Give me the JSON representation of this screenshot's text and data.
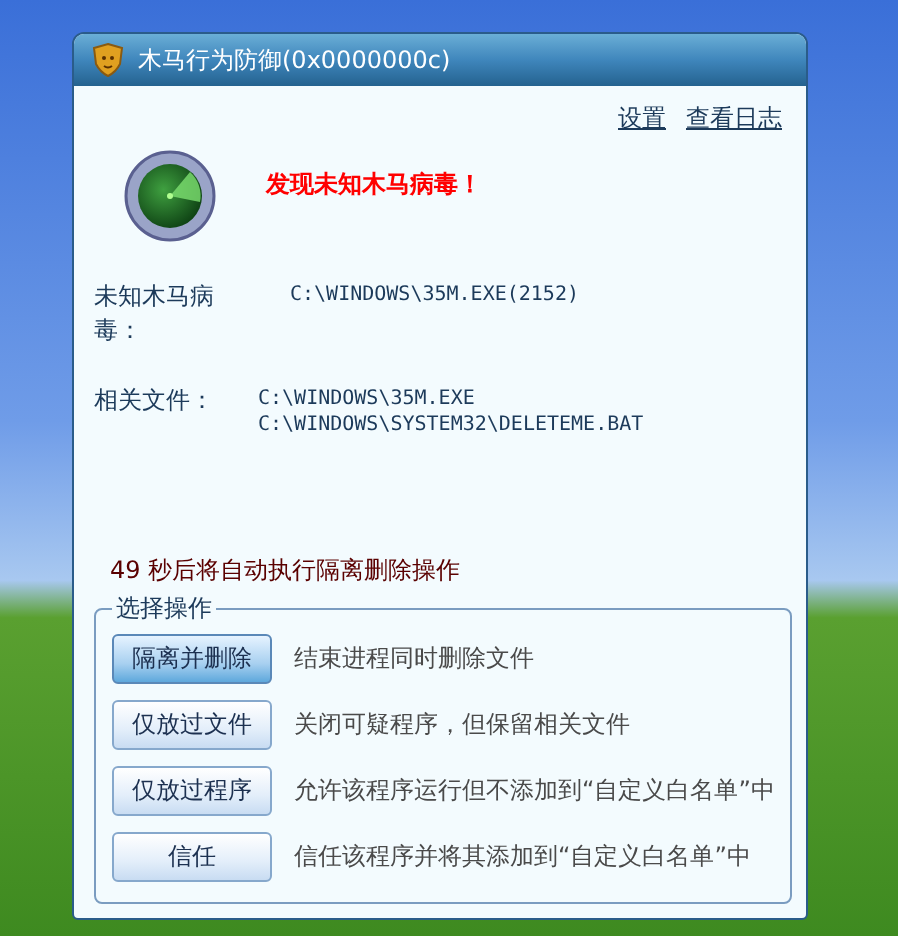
{
  "window": {
    "title": "木马行为防御(0x0000000c)"
  },
  "links": [
    "设置",
    "查看日志"
  ],
  "alert": "发现未知木马病毒！",
  "details": [
    {
      "label": "未知木马病毒：",
      "values": [
        "C:\\WINDOWS\\35M.EXE(2152)"
      ]
    },
    {
      "label": "相关文件：",
      "values": [
        "C:\\WINDOWS\\35M.EXE",
        "C:\\WINDOWS\\SYSTEM32\\DELETEME.BAT"
      ]
    }
  ],
  "countdown": "49 秒后将自动执行隔离删除操作",
  "actions": {
    "title": "选择操作",
    "items": [
      {
        "button": "隔离并删除",
        "description": "结束进程同时删除文件",
        "focused": true
      },
      {
        "button": "仅放过文件",
        "description": "关闭可疑程序，但保留相关文件",
        "focused": false
      },
      {
        "button": "仅放过程序",
        "description": "允许该程序运行但不添加到“自定义白名单”中",
        "focused": false
      },
      {
        "button": "信任",
        "description": "信任该程序并将其添加到“自定义白名单”中",
        "focused": false
      }
    ]
  }
}
